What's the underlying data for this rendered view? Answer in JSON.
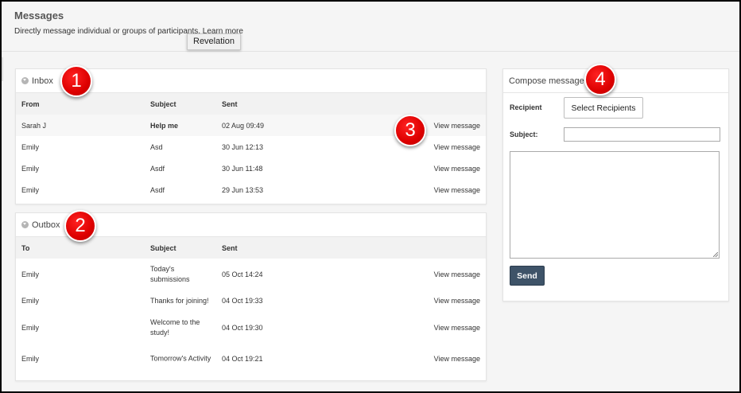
{
  "header": {
    "title": "Messages",
    "subtitle": "Directly message individual or groups of participants.",
    "learn_more": "Learn more",
    "tooltip": "Revelation"
  },
  "inbox": {
    "title": "Inbox",
    "columns": {
      "from": "From",
      "subject": "Subject",
      "sent": "Sent"
    },
    "rows": [
      {
        "from": "Sarah J",
        "subject": "Help me",
        "sent": "02 Aug 09:49",
        "action": "View message",
        "unread": true
      },
      {
        "from": "Emily",
        "subject": "Asd",
        "sent": "30 Jun 12:13",
        "action": "View message",
        "unread": false
      },
      {
        "from": "Emily",
        "subject": "Asdf",
        "sent": "30 Jun 11:48",
        "action": "View message",
        "unread": false
      },
      {
        "from": "Emily",
        "subject": "Asdf",
        "sent": "29 Jun 13:53",
        "action": "View message",
        "unread": false
      }
    ]
  },
  "outbox": {
    "title": "Outbox",
    "columns": {
      "to": "To",
      "subject": "Subject",
      "sent": "Sent"
    },
    "rows": [
      {
        "to": "Emily",
        "subject": "Today's submissions",
        "sent": "05 Oct 14:24",
        "action": "View message"
      },
      {
        "to": "Emily",
        "subject": "Thanks for joining!",
        "sent": "04 Oct 19:33",
        "action": "View message"
      },
      {
        "to": "Emily",
        "subject": "Welcome to the study!",
        "sent": "04 Oct 19:30",
        "action": "View message"
      },
      {
        "to": "Emily",
        "subject": "Tomorrow's Activity",
        "sent": "04 Oct 19:21",
        "action": "View message"
      }
    ]
  },
  "compose": {
    "title": "Compose message",
    "recipient_label": "Recipient",
    "select_button": "Select Recipients",
    "subject_label": "Subject:",
    "subject_value": "",
    "body_value": "",
    "send_button": "Send"
  },
  "badges": [
    "1",
    "2",
    "3",
    "4"
  ],
  "colors": {
    "badge": "#dd0000",
    "send_button": "#3e5368",
    "header_bg": "#f2f2f2"
  }
}
